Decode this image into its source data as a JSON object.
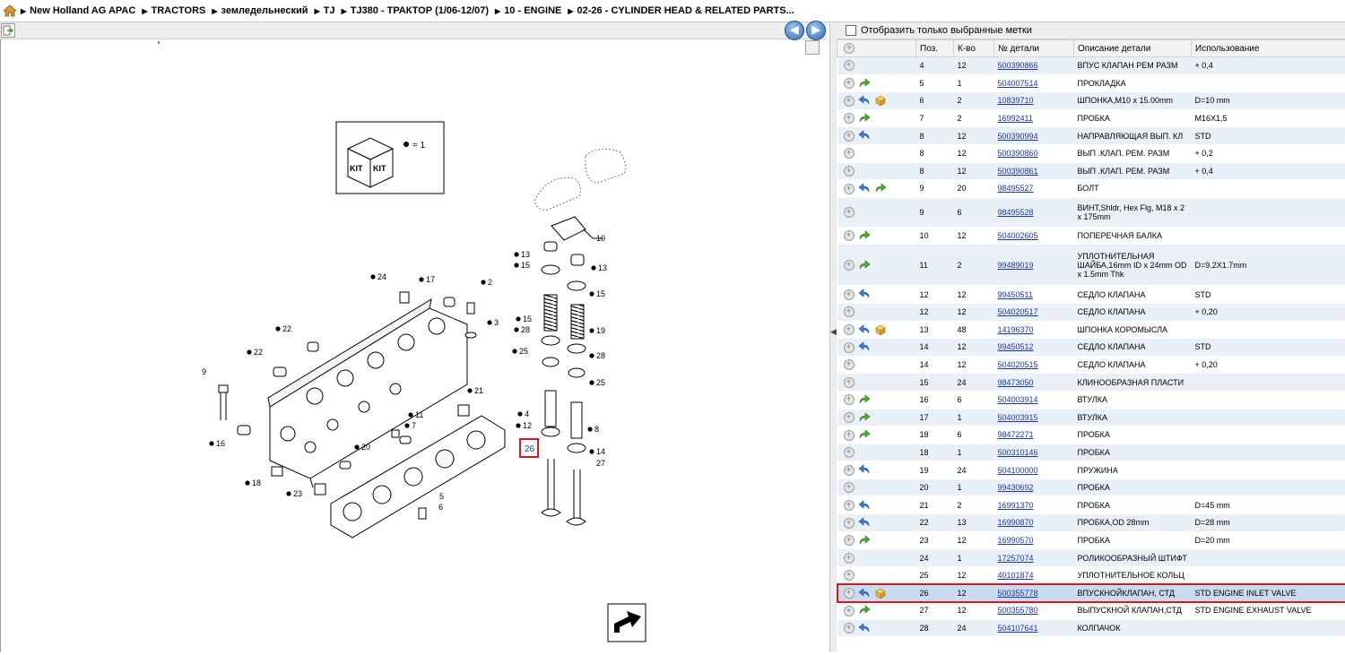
{
  "breadcrumb": [
    "New Holland AG APAC",
    "TRACTORS",
    "земледельнеский",
    "TJ",
    "TJ380 - ТРАКТОР (1/06-12/07)",
    "10 - ENGINE",
    "02-26 - CYLINDER HEAD & RELATED PARTS..."
  ],
  "nav": {
    "back": "◀",
    "forward": "▶"
  },
  "filter": {
    "label": "Отобразить только выбранные метки",
    "checked": false
  },
  "columns": [
    "Поз.",
    "К-во",
    "№ детали",
    "Описание детали",
    "Использование"
  ],
  "rows": [
    {
      "pos": "4",
      "qty": "12",
      "part": "500390866",
      "desc": "ВПУС КЛАПАН РЕМ РАЗМ",
      "usage": "+ 0,4",
      "icons": []
    },
    {
      "pos": "5",
      "qty": "1",
      "part": "504007514",
      "desc": "ПРОКЛАДКА",
      "usage": "",
      "icons": [
        "green-arrow"
      ]
    },
    {
      "pos": "6",
      "qty": "2",
      "part": "10839710",
      "desc": "ШПОНКА,M10 x 15.00mm",
      "usage": "D=10 mm",
      "icons": [
        "blue-arrow",
        "box"
      ]
    },
    {
      "pos": "7",
      "qty": "2",
      "part": "16992411",
      "desc": "ПРОБКА",
      "usage": "M16X1,5",
      "icons": [
        "green-arrow"
      ]
    },
    {
      "pos": "8",
      "qty": "12",
      "part": "500390994",
      "desc": "НАПРАВЛЯЮЩАЯ ВЫП. КЛ",
      "usage": "STD",
      "icons": [
        "blue-arrow"
      ]
    },
    {
      "pos": "8",
      "qty": "12",
      "part": "500390860",
      "desc": "ВЫП .КЛАП. РЕМ. РАЗМ",
      "usage": "+ 0,2",
      "icons": []
    },
    {
      "pos": "8",
      "qty": "12",
      "part": "500390861",
      "desc": "ВЫП .КЛАП. РЕМ. РАЗМ",
      "usage": "+ 0,4",
      "icons": []
    },
    {
      "pos": "9",
      "qty": "20",
      "part": "98495527",
      "desc": "БОЛТ",
      "usage": "",
      "icons": [
        "blue-arrow",
        "green-arrow"
      ]
    },
    {
      "pos": "9",
      "qty": "6",
      "part": "98495528",
      "desc": "ВИНТ,Shldr, Hex Flg, M18 x 2 x 175mm",
      "usage": "",
      "icons": []
    },
    {
      "pos": "10",
      "qty": "12",
      "part": "504002605",
      "desc": "ПОПЕРЕЧНАЯ БАЛКА",
      "usage": "",
      "icons": [
        "green-arrow"
      ]
    },
    {
      "pos": "11",
      "qty": "2",
      "part": "99489019",
      "desc": "УПЛОТНИТЕЛЬНАЯ ШАЙБА,16mm ID x 24mm OD x 1.5mm Thk",
      "usage": "D=9.2X1.7mm",
      "icons": [
        "green-arrow"
      ]
    },
    {
      "pos": "12",
      "qty": "12",
      "part": "99450511",
      "desc": "СЕДЛО КЛАПАНА",
      "usage": "STD",
      "icons": [
        "blue-arrow"
      ]
    },
    {
      "pos": "12",
      "qty": "12",
      "part": "504020517",
      "desc": "СЕДЛО КЛАПАНА",
      "usage": "+ 0,20",
      "icons": []
    },
    {
      "pos": "13",
      "qty": "48",
      "part": "14196370",
      "desc": "ШПОНКА КОРОМЫСЛА",
      "usage": "",
      "icons": [
        "blue-arrow",
        "box"
      ]
    },
    {
      "pos": "14",
      "qty": "12",
      "part": "99450512",
      "desc": "СЕДЛО КЛАПАНА",
      "usage": "STD",
      "icons": [
        "blue-arrow"
      ]
    },
    {
      "pos": "14",
      "qty": "12",
      "part": "504020515",
      "desc": "СЕДЛО КЛАПАНА",
      "usage": "+ 0,20",
      "icons": []
    },
    {
      "pos": "15",
      "qty": "24",
      "part": "98473050",
      "desc": "КЛИНООБРАЗНАЯ ПЛАСТИ",
      "usage": "",
      "icons": []
    },
    {
      "pos": "16",
      "qty": "6",
      "part": "504003914",
      "desc": "ВТУЛКА",
      "usage": "",
      "icons": [
        "green-arrow"
      ]
    },
    {
      "pos": "17",
      "qty": "1",
      "part": "504003915",
      "desc": "ВТУЛКА",
      "usage": "",
      "icons": [
        "green-arrow"
      ]
    },
    {
      "pos": "18",
      "qty": "6",
      "part": "98472271",
      "desc": "ПРОБКА",
      "usage": "",
      "icons": [
        "green-arrow"
      ]
    },
    {
      "pos": "18",
      "qty": "1",
      "part": "500310146",
      "desc": "ПРОБКА",
      "usage": "",
      "icons": []
    },
    {
      "pos": "19",
      "qty": "24",
      "part": "504100000",
      "desc": "ПРУЖИНА",
      "usage": "",
      "icons": [
        "blue-arrow"
      ]
    },
    {
      "pos": "20",
      "qty": "1",
      "part": "99430692",
      "desc": "ПРОБКА",
      "usage": "",
      "icons": []
    },
    {
      "pos": "21",
      "qty": "2",
      "part": "16991370",
      "desc": "ПРОБКА",
      "usage": "D=45 mm",
      "icons": [
        "blue-arrow"
      ]
    },
    {
      "pos": "22",
      "qty": "13",
      "part": "16990870",
      "desc": "ПРОБКА,OD 28mm",
      "usage": "D=28 mm",
      "icons": [
        "blue-arrow"
      ]
    },
    {
      "pos": "23",
      "qty": "12",
      "part": "16990570",
      "desc": "ПРОБКА",
      "usage": "D=20 mm",
      "icons": [
        "green-arrow"
      ]
    },
    {
      "pos": "24",
      "qty": "1",
      "part": "17257074",
      "desc": "РОЛИКООБРАЗНЫЙ ШТИФТ",
      "usage": "",
      "icons": []
    },
    {
      "pos": "25",
      "qty": "12",
      "part": "40101874",
      "desc": "УПЛОТНИТЕЛЬНОЕ КОЛЬЦ",
      "usage": "",
      "icons": []
    },
    {
      "pos": "26",
      "qty": "12",
      "part": "500355778",
      "desc": "ВПУСКНОЙКЛАПАН, СТД",
      "usage": "STD ENGINE INLET VALVE",
      "icons": [
        "blue-arrow",
        "box"
      ],
      "selected": true
    },
    {
      "pos": "27",
      "qty": "12",
      "part": "500355780",
      "desc": "ВЫПУСКНОЙ КЛАПАН,СТД",
      "usage": "STD ENGINE EXHAUST VALVE",
      "icons": [
        "green-arrow"
      ]
    },
    {
      "pos": "28",
      "qty": "24",
      "part": "504107641",
      "desc": "КОЛПАЧОК",
      "usage": "",
      "icons": [
        "blue-arrow"
      ]
    }
  ],
  "diagram": {
    "kit_text": "KIT",
    "kit_qty": "= 1",
    "callouts": [
      "10",
      "13",
      "13",
      "15",
      "15",
      "15",
      "19",
      "28",
      "28",
      "25",
      "25",
      "4",
      "12",
      "8",
      "14",
      "27",
      "24",
      "17",
      "2",
      "3",
      "22",
      "22",
      "9",
      "16",
      "18",
      "23",
      "21",
      "11",
      "7",
      "20",
      "5",
      "6"
    ],
    "highlight": "26"
  }
}
